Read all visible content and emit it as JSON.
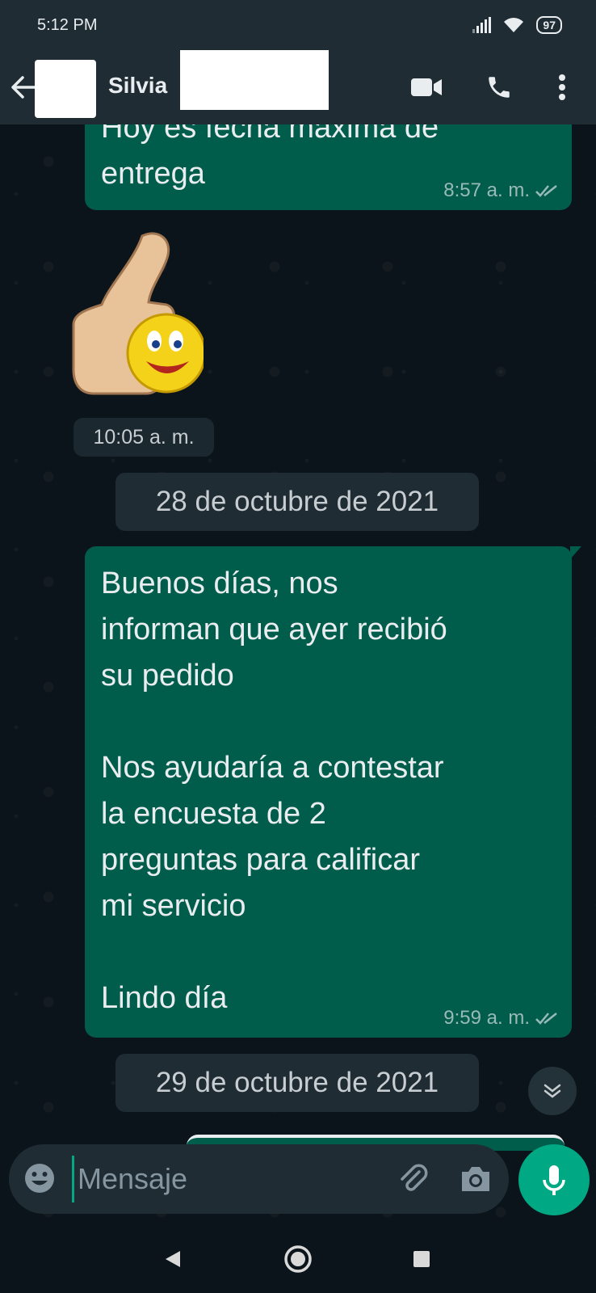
{
  "status_bar": {
    "time": "5:12 PM",
    "battery": "97"
  },
  "header": {
    "contact_name": "Silvia"
  },
  "messages": [
    {
      "text": "Hoy es fecha máxima de\nentrega",
      "time": "8:57 a. m."
    },
    {
      "sticker_time": "10:05 a. m."
    },
    {
      "date_separator": "28 de octubre de 2021"
    },
    {
      "text": "Buenos días, nos\ninforman que ayer recibió\nsu pedido\n\nNos  ayudaría a contestar\nla encuesta de 2\npreguntas para calificar\nmi servicio\n\nLindo día",
      "time": "9:59 a. m."
    },
    {
      "date_separator": "29 de octubre de 2021"
    }
  ],
  "composer": {
    "placeholder": "Mensaje"
  },
  "colors": {
    "outgoing_bubble": "#005c4b",
    "accent": "#00a884",
    "header": "#1f2c34",
    "background": "#0b141a"
  },
  "icons": [
    "back-arrow-icon",
    "video-call-icon",
    "phone-icon",
    "more-options-icon",
    "emoji-icon",
    "attach-icon",
    "camera-icon",
    "mic-icon",
    "scroll-down-icon",
    "nav-back-icon",
    "nav-home-icon",
    "nav-recents-icon"
  ]
}
